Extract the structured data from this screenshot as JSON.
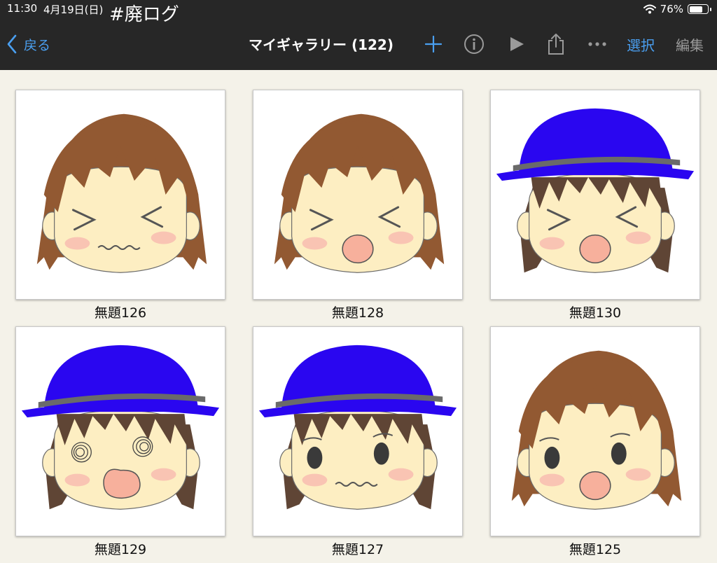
{
  "status": {
    "time": "11:30",
    "date": "4月19日(日)",
    "battery_percent": "76%",
    "battery_level": 0.76
  },
  "overlay": {
    "title": "#廃ログ"
  },
  "nav": {
    "back_label": "戻る",
    "title": "マイギャラリー (122)",
    "select_label": "選択",
    "edit_label": "編集"
  },
  "icons": [
    "chevron-left-icon",
    "plus-icon",
    "info-icon",
    "play-icon",
    "share-icon",
    "more-icon",
    "wifi-icon",
    "battery-icon"
  ],
  "colors": {
    "accent": "#4a9ff0",
    "disabled": "#9a9a9a",
    "hair_brown": "#925932",
    "hair_dark": "#5f4535",
    "hat": "#2a06f0",
    "hat_band": "#6a6a6a",
    "skin": "#fdeec2",
    "blush": "#f8bcb0"
  },
  "gallery": [
    {
      "name": "無題126",
      "hat": false,
      "eyes": "squint",
      "mouth": "wavy"
    },
    {
      "name": "無題128",
      "hat": false,
      "eyes": "squint",
      "mouth": "open"
    },
    {
      "name": "無題130",
      "hat": true,
      "eyes": "squint",
      "mouth": "open"
    },
    {
      "name": "無題129",
      "hat": true,
      "eyes": "swirl",
      "mouth": "pout"
    },
    {
      "name": "無題127",
      "hat": true,
      "eyes": "dot",
      "mouth": "wavy"
    },
    {
      "name": "無題125",
      "hat": false,
      "eyes": "dot",
      "mouth": "open"
    }
  ]
}
